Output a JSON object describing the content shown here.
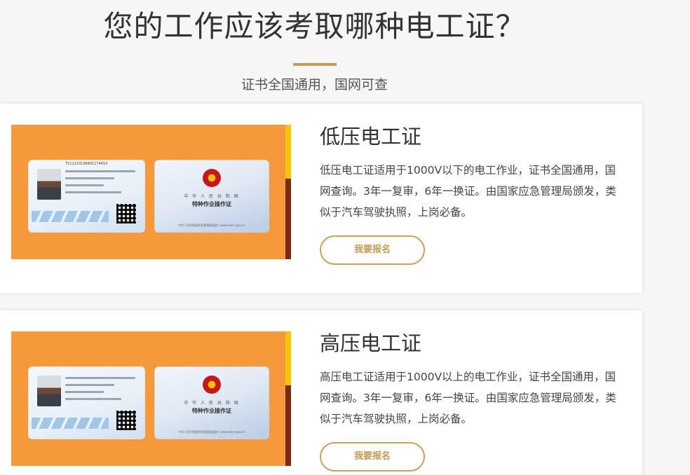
{
  "header": {
    "title": "您的工作应该考取哪种电工证？",
    "subtitle": "证书全国通用，国网可查"
  },
  "colors": {
    "accent": "#c49a55",
    "card_image_bg": "#f6993a",
    "page_bg": "#f6f6f6"
  },
  "cards": [
    {
      "title": "低压电工证",
      "description": "低压电工证适用于1000V以下的电工作业，证书全国通用，国网查询。3年一复审，6年一换证。由国家应急管理局颁发，类似于汽车驾驶执照，上岗必备。",
      "button_label": "我要报名",
      "image": {
        "id_serial": "T51222319680117441X",
        "cert_country": "中 华 人 民 共 和 国",
        "cert_name": "特种作业操作证",
        "cert_footer": "中华人民共和国应急管理部监制 | www.mem.gov.cn"
      }
    },
    {
      "title": "高压电工证",
      "description": "高压电工证适用于1000V以上的电工作业，证书全国通用，国网查询。3年一复审，6年一换证。由国家应急管理局颁发，类似于汽车驾驶执照，上岗必备。",
      "button_label": "我要报名",
      "image": {
        "id_serial": "",
        "cert_country": "中 华 人 民 共 和 国",
        "cert_name": "特种作业操作证",
        "cert_footer": "中华人民共和国应急管理部监制 | www.mem.gov.cn"
      }
    }
  ]
}
